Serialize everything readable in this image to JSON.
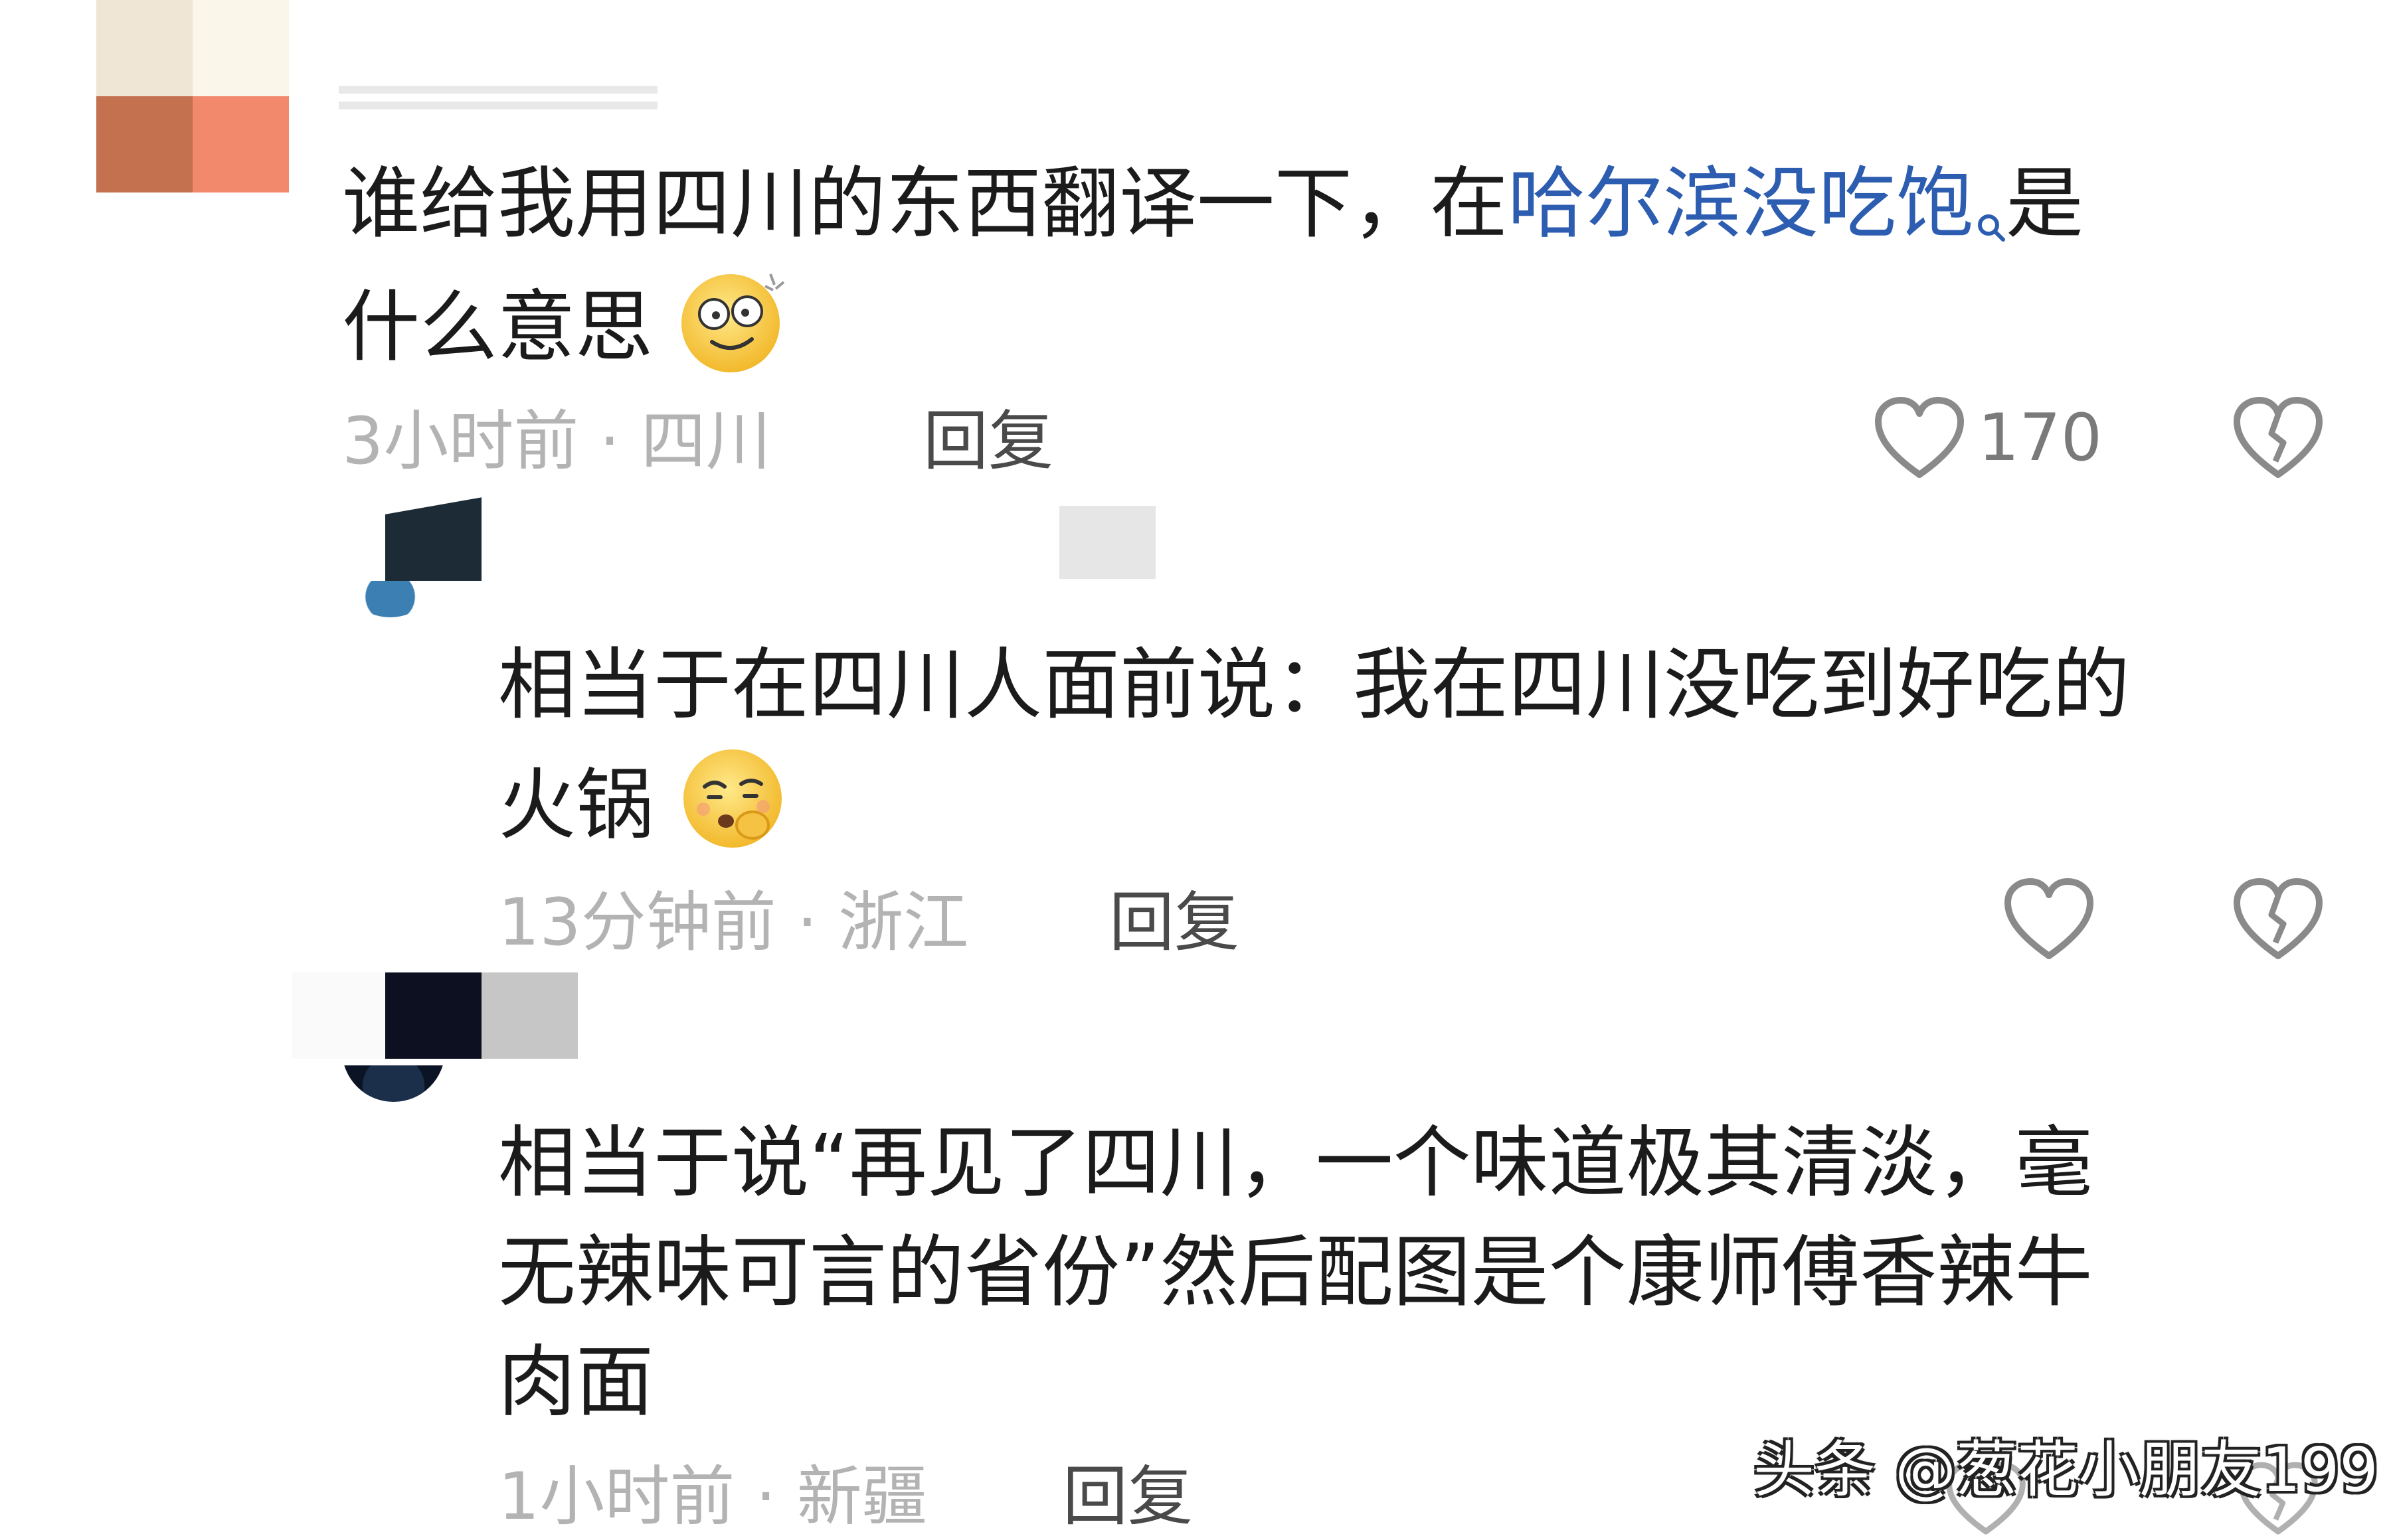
{
  "comments": [
    {
      "text_before": "谁给我用四川的东西翻译一下，在",
      "link_text": "哈尔滨没吃饱",
      "text_after": "是",
      "line2": "什么意思",
      "time": "3小时前",
      "location": "四川",
      "reply_label": "回复",
      "like_count": "170",
      "emoji": "dizzy-smile-emoji"
    },
    {
      "line1": "相当于在四川人面前说：我在四川没吃到好吃的",
      "line2": "火锅",
      "time": "13分钟前",
      "location": "浙江",
      "reply_label": "回复",
      "emoji": "shushing-face-emoji"
    },
    {
      "line1": "相当于说“再见了四川，一个味道极其清淡，毫",
      "line2": "无辣味可言的省份”然后配图是个康师傅香辣牛",
      "line3": "肉面",
      "time": "1小时前",
      "location": "新疆",
      "reply_label": "回复"
    }
  ],
  "separator": " · ",
  "watermark": "头条 @葱花小朋友199",
  "icons": {
    "like": "heart-outline-icon",
    "dislike": "broken-heart-icon",
    "search": "search-icon"
  },
  "colors": {
    "link": "#2d5db0",
    "meta": "#b3b3b3",
    "text": "#1b1b1b"
  }
}
